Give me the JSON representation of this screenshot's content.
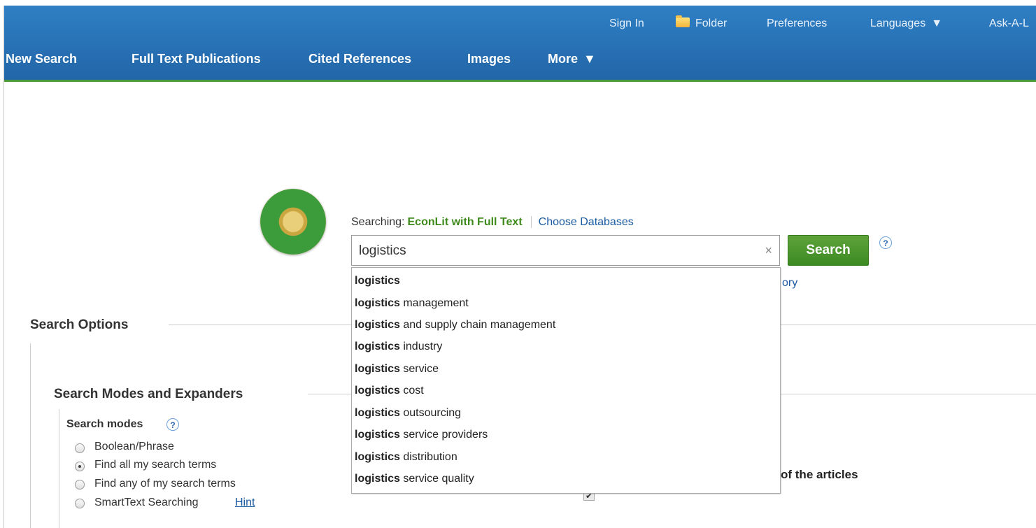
{
  "header": {
    "top_links": [
      "Sign In",
      "Folder",
      "Preferences",
      "Languages",
      "Ask-A-L"
    ],
    "nav": [
      "New Search",
      "Full Text Publications",
      "Cited References",
      "Images",
      "More"
    ]
  },
  "search": {
    "searching_label": "Searching:",
    "database": "EconLit with Full Text",
    "choose_databases": "Choose Databases",
    "query": "logistics",
    "clear_symbol": "×",
    "button": "Search",
    "help": "?",
    "partial_link": "ory"
  },
  "autocomplete": {
    "term": "logistics",
    "suggestions": [
      {
        "bold": "logistics",
        "rest": ""
      },
      {
        "bold": "logistics",
        "rest": " management"
      },
      {
        "bold": "logistics",
        "rest": " and supply chain management"
      },
      {
        "bold": "logistics",
        "rest": " industry"
      },
      {
        "bold": "logistics",
        "rest": " service"
      },
      {
        "bold": "logistics",
        "rest": " cost"
      },
      {
        "bold": "logistics",
        "rest": " outsourcing"
      },
      {
        "bold": "logistics",
        "rest": " service providers"
      },
      {
        "bold": "logistics",
        "rest": " distribution"
      },
      {
        "bold": "logistics",
        "rest": " service quality"
      }
    ]
  },
  "options": {
    "title": "Search Options",
    "modes_section": "Search Modes and Expanders",
    "modes_label": "Search modes",
    "modes": [
      {
        "label": "Boolean/Phrase",
        "selected": false
      },
      {
        "label": "Find all my search terms",
        "selected": true
      },
      {
        "label": "Find any of my search terms",
        "selected": false
      },
      {
        "label": "SmartText Searching",
        "selected": false
      }
    ],
    "hint": "Hint",
    "expander_partial": "of the articles"
  },
  "colors": {
    "header_blue": "#2266a8",
    "accent_green": "#3e8b1b",
    "link_blue": "#1a5aa0"
  }
}
